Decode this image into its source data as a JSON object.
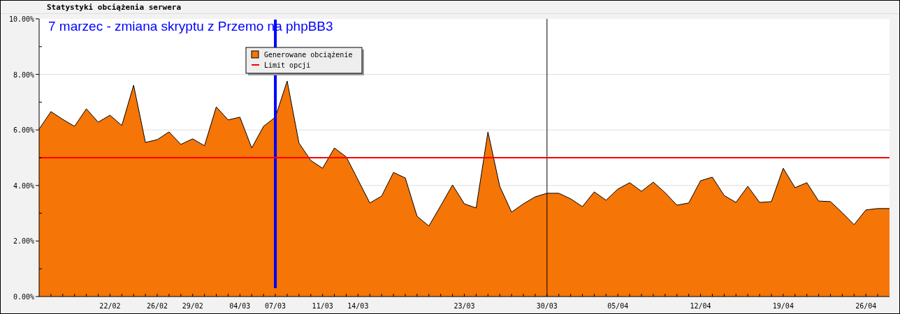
{
  "panel": {
    "title": "Statystyki obciążenia serwera",
    "chart_data": {
      "type": "area",
      "categories": [
        null,
        null,
        null,
        null,
        null,
        null,
        "22/02",
        null,
        null,
        null,
        "26/02",
        null,
        null,
        "29/02",
        null,
        null,
        null,
        "04/03",
        null,
        null,
        "07/03",
        null,
        null,
        null,
        "11/03",
        null,
        null,
        "14/03",
        null,
        null,
        null,
        null,
        null,
        null,
        null,
        null,
        "23/03",
        null,
        null,
        null,
        null,
        null,
        null,
        "30/03",
        null,
        null,
        null,
        null,
        null,
        "05/04",
        null,
        null,
        null,
        null,
        null,
        null,
        "12/04",
        null,
        null,
        null,
        null,
        null,
        null,
        "19/04",
        null,
        null,
        null,
        null,
        null,
        null,
        "26/04",
        null,
        null
      ],
      "series": [
        {
          "name": "Generowane obciążenie",
          "color": "#f57507",
          "values": [
            6.03,
            6.66,
            6.38,
            6.13,
            6.76,
            6.28,
            6.53,
            6.16,
            7.61,
            5.55,
            5.65,
            5.93,
            5.48,
            5.68,
            5.43,
            6.83,
            6.36,
            6.46,
            5.35,
            6.13,
            6.46,
            7.76,
            5.53,
            4.9,
            4.62,
            5.35,
            5.03,
            4.2,
            3.37,
            3.62,
            4.47,
            4.27,
            2.89,
            2.54,
            3.27,
            4.02,
            3.34,
            3.19,
            5.93,
            3.97,
            3.04,
            3.34,
            3.59,
            3.72,
            3.72,
            3.52,
            3.24,
            3.77,
            3.47,
            3.87,
            4.1,
            3.79,
            4.12,
            3.74,
            3.29,
            3.37,
            4.17,
            4.3,
            3.64,
            3.39,
            3.97,
            3.39,
            3.42,
            4.62,
            3.92,
            4.1,
            3.44,
            3.42,
            3.02,
            2.59,
            3.12,
            3.17,
            3.17
          ]
        }
      ],
      "ylim": [
        0,
        10
      ],
      "yticks": [
        {
          "value": 0,
          "label": "0.00%"
        },
        {
          "value": 2,
          "label": "2.00%"
        },
        {
          "value": 4,
          "label": "4.00%"
        },
        {
          "value": 6,
          "label": "6.00%"
        },
        {
          "value": 8,
          "label": "8.00%"
        },
        {
          "value": 10,
          "label": "10.00%"
        }
      ],
      "ref_lines": [
        {
          "axis": "y",
          "value": 5,
          "label": "Limit opcji",
          "color": "#ff0000"
        },
        {
          "axis": "x",
          "value": "07/03",
          "color": "#0000ff"
        },
        {
          "axis": "x",
          "value": "30/03",
          "color": "#000000"
        }
      ],
      "grid": true,
      "legend": true,
      "annotations": [
        "7 marzec - zmiana skryptu z Przemo na phpBB3"
      ]
    }
  }
}
